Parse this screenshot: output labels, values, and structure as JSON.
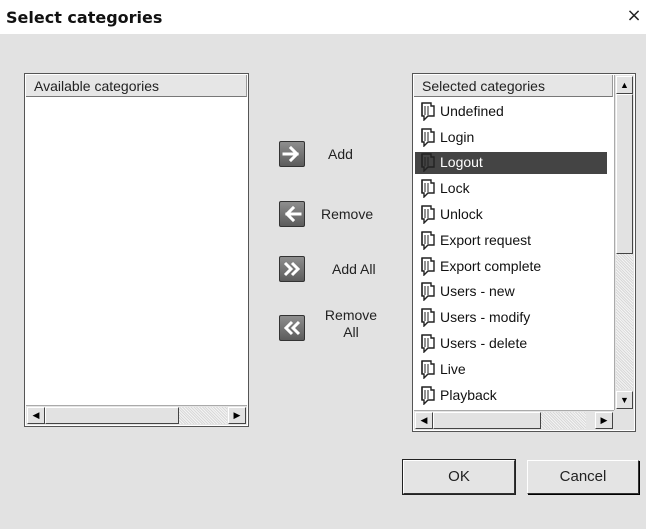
{
  "dialog": {
    "title": "Select categories",
    "close_glyph": "×"
  },
  "available": {
    "header": "Available categories",
    "items": []
  },
  "selected": {
    "header": "Selected categories",
    "items": [
      {
        "label": "Undefined",
        "icon": "category-icon"
      },
      {
        "label": "Login",
        "icon": "category-icon"
      },
      {
        "label": "Logout",
        "icon": "category-icon",
        "selected": true
      },
      {
        "label": "Lock",
        "icon": "category-icon"
      },
      {
        "label": "Unlock",
        "icon": "category-icon"
      },
      {
        "label": "Export request",
        "icon": "category-icon"
      },
      {
        "label": "Export complete",
        "icon": "category-icon"
      },
      {
        "label": "Users - new",
        "icon": "category-icon"
      },
      {
        "label": "Users - modify",
        "icon": "category-icon"
      },
      {
        "label": "Users - delete",
        "icon": "category-icon"
      },
      {
        "label": "Live",
        "icon": "category-icon"
      },
      {
        "label": "Playback",
        "icon": "category-icon"
      }
    ]
  },
  "actions": {
    "add": {
      "label": "Add",
      "icon": "arrow-right-icon"
    },
    "remove": {
      "label": "Remove",
      "icon": "arrow-left-icon"
    },
    "add_all": {
      "label": "Add All",
      "icon": "double-chevron-right-icon"
    },
    "remove_all": {
      "label": "Remove All",
      "icon": "double-chevron-left-icon"
    }
  },
  "buttons": {
    "ok": "OK",
    "cancel": "Cancel"
  },
  "scroll": {
    "left_arrow": "◀",
    "right_arrow": "▶",
    "up_arrow": "▲",
    "down_arrow": "▼"
  }
}
